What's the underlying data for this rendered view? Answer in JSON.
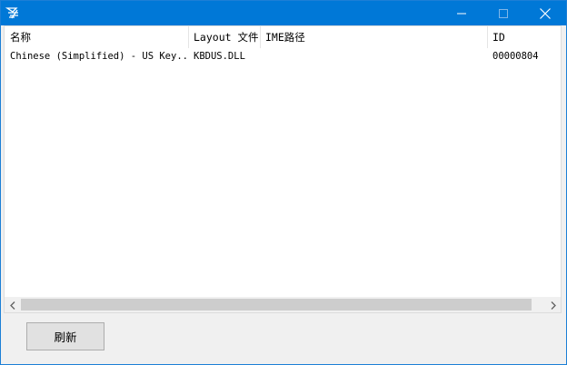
{
  "window": {
    "icon": "app-logo-icon",
    "controls": {
      "minimize_icon": "minimize-icon",
      "maximize_icon": "maximize-icon",
      "close_icon": "close-icon"
    }
  },
  "list": {
    "columns": [
      "名称",
      "Layout 文件",
      "IME路径",
      "ID"
    ],
    "rows": [
      {
        "name": "Chinese (Simplified) - US Key...",
        "layout": "KBDUS.DLL",
        "ime": "",
        "id": "00000804"
      }
    ]
  },
  "scrollbar": {
    "left_icon": "chevron-left-icon",
    "right_icon": "chevron-right-icon"
  },
  "actions": {
    "refresh_label": "刷新"
  },
  "colors": {
    "titlebar": "#0078d7",
    "window_bg": "#f0f0f0",
    "scroll_thumb": "#cdcdcd"
  }
}
